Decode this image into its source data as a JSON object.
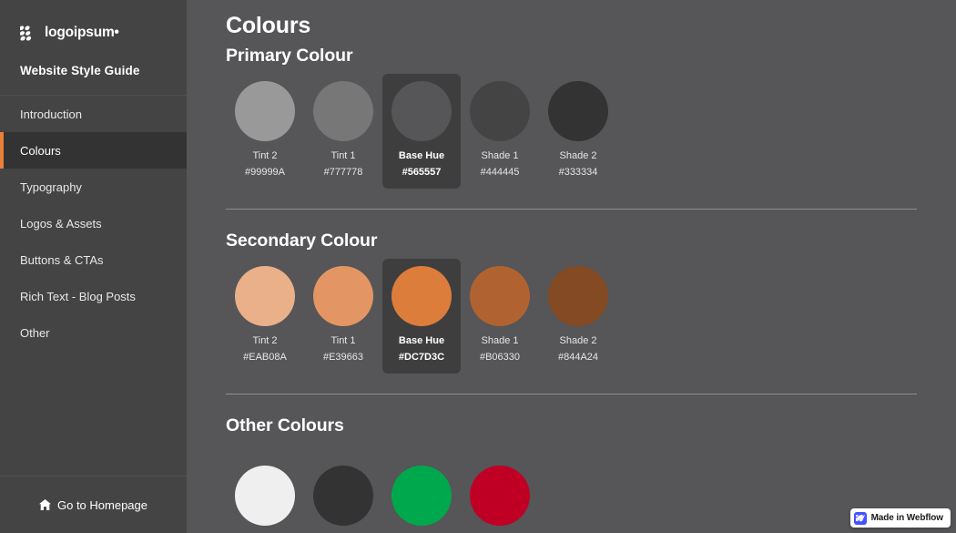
{
  "sidebar": {
    "brand": {
      "name": "logoipsum",
      "trademark": "•",
      "logo_icon": "logoipsum-mark-icon"
    },
    "guide_title": "Website Style Guide",
    "items": [
      {
        "label": "Introduction",
        "active": false
      },
      {
        "label": "Colours",
        "active": true
      },
      {
        "label": "Typography",
        "active": false
      },
      {
        "label": "Logos & Assets",
        "active": false
      },
      {
        "label": "Buttons & CTAs",
        "active": false
      },
      {
        "label": "Rich Text - Blog Posts",
        "active": false
      },
      {
        "label": "Other",
        "active": false
      }
    ],
    "active_accent": "#e8803a",
    "footer": {
      "label": "Go to Homepage",
      "icon": "home-icon"
    }
  },
  "main": {
    "page_title": "Colours",
    "sections": [
      {
        "title": "Primary Colour",
        "swatches": [
          {
            "name": "Tint 2",
            "hex": "#99999A",
            "base": false
          },
          {
            "name": "Tint 1",
            "hex": "#777778",
            "base": false
          },
          {
            "name": "Base Hue",
            "hex": "#565557",
            "base": true
          },
          {
            "name": "Shade 1",
            "hex": "#444445",
            "base": false
          },
          {
            "name": "Shade 2",
            "hex": "#333334",
            "base": false
          }
        ]
      },
      {
        "title": "Secondary Colour",
        "swatches": [
          {
            "name": "Tint 2",
            "hex": "#EAB08A",
            "base": false
          },
          {
            "name": "Tint 1",
            "hex": "#E39663",
            "base": false
          },
          {
            "name": "Base Hue",
            "hex": "#DC7D3C",
            "base": true
          },
          {
            "name": "Shade 1",
            "hex": "#B06330",
            "base": false
          },
          {
            "name": "Shade 2",
            "hex": "#844A24",
            "base": false
          }
        ]
      },
      {
        "title": "Other Colours",
        "swatches": [
          {
            "name": "",
            "hex": "#EFEFEF",
            "base": false
          },
          {
            "name": "",
            "hex": "#333334",
            "base": false
          },
          {
            "name": "",
            "hex": "#00A84D",
            "base": false
          },
          {
            "name": "",
            "hex": "#BF0024",
            "base": false
          }
        ]
      }
    ]
  },
  "webflow_badge": {
    "label": "Made in Webflow",
    "icon": "webflow-w-icon",
    "color": "#4353ff"
  }
}
